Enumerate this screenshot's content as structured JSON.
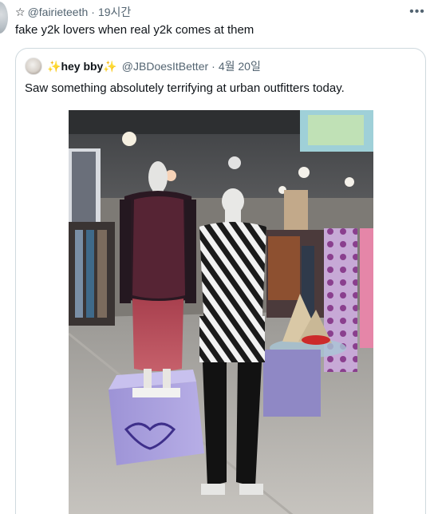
{
  "tweet": {
    "star": "☆",
    "handle": "@fairieteeth",
    "separator": "·",
    "time": "19시간",
    "text": "fake y2k lovers when real y2k comes at them",
    "more_icon": "more-horizontal-icon"
  },
  "quote": {
    "sparkle_left": "✨",
    "display_name": "hey bby",
    "sparkle_right": "✨",
    "handle": "@JBDoesItBetter",
    "separator": "·",
    "time": "4월 20일",
    "text": "Saw something absolutely terrifying at urban outfitters today.",
    "image_alt": "Store mannequins in y2k outfits at Urban Outfitters"
  }
}
